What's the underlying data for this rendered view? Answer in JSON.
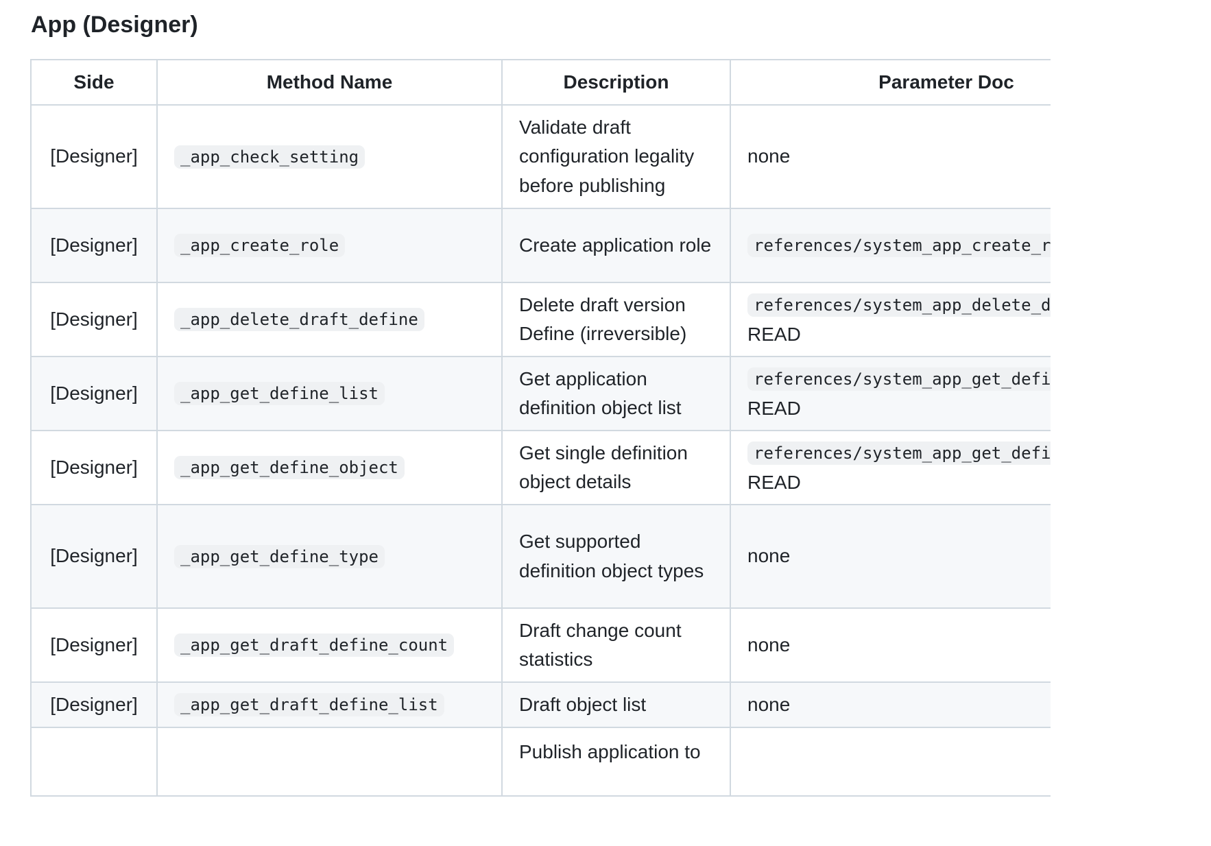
{
  "page_title": "App (Designer)",
  "table": {
    "headers": [
      "Side",
      "Method Name",
      "Description",
      "Parameter Doc"
    ],
    "rows": [
      {
        "side": "[Designer]",
        "method": "_app_check_setting",
        "description": "Validate draft configuration legality before publishing",
        "param_code": "",
        "param_text": "none"
      },
      {
        "side": "[Designer]",
        "method": "_app_create_role",
        "description": "Create application role",
        "param_code": "references/system_app_create_r",
        "param_text": ""
      },
      {
        "side": "[Designer]",
        "method": "_app_delete_draft_define",
        "description": "Delete draft version Define (irreversible)",
        "param_code": "references/system_app_delete_d",
        "param_text": "READ"
      },
      {
        "side": "[Designer]",
        "method": "_app_get_define_list",
        "description": "Get application definition object list",
        "param_code": "references/system_app_get_defi",
        "param_text": "READ"
      },
      {
        "side": "[Designer]",
        "method": "_app_get_define_object",
        "description": "Get single definition object details",
        "param_code": "references/system_app_get_defi",
        "param_text": "READ"
      },
      {
        "side": "[Designer]",
        "method": "_app_get_define_type",
        "description": "Get supported definition object types",
        "param_code": "",
        "param_text": "none"
      },
      {
        "side": "[Designer]",
        "method": "_app_get_draft_define_count",
        "description": "Draft change count statistics",
        "param_code": "",
        "param_text": "none"
      },
      {
        "side": "[Designer]",
        "method": "_app_get_draft_define_list",
        "description": "Draft object list",
        "param_code": "",
        "param_text": "none"
      },
      {
        "side": "",
        "method": "",
        "description": "Publish application to",
        "param_code": "",
        "param_text": ""
      }
    ]
  }
}
